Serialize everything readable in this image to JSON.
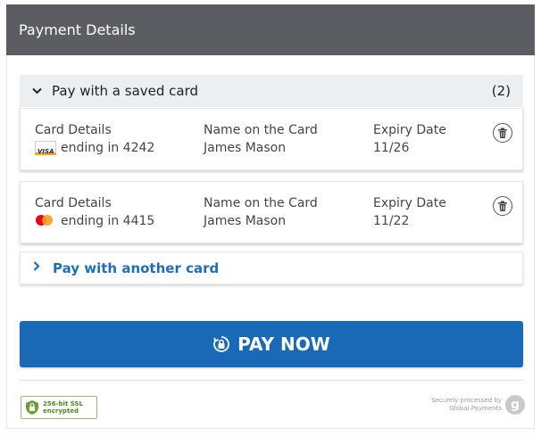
{
  "header": {
    "title": "Payment Details"
  },
  "saved_cards": {
    "heading": "Pay with a saved card",
    "count": "(2)",
    "cards": [
      {
        "card_details_label": "Card Details",
        "brand_icon": "visa-icon",
        "brand_text": "VISA",
        "ending": "ending in 4242",
        "name_label": "Name on the Card",
        "name": "James Mason",
        "expiry_label": "Expiry Date",
        "expiry": "11/26"
      },
      {
        "card_details_label": "Card Details",
        "brand_icon": "mastercard-icon",
        "ending": "ending in 4415",
        "name_label": "Name on the Card",
        "name": "James Mason",
        "expiry_label": "Expiry Date",
        "expiry": "11/22"
      }
    ]
  },
  "another_card": {
    "label": "Pay with another card"
  },
  "pay_button": {
    "label": "PAY NOW"
  },
  "footer": {
    "ssl_line1": "256-bit SSL",
    "ssl_line2": "encrypted",
    "secured_line1": "Securely processed by",
    "secured_line2": "Global Payments",
    "logo_letter": "g"
  },
  "colors": {
    "header_bg": "#5b5d63",
    "accent": "#1a69b6",
    "link": "#1e6fb7",
    "ssl_green": "#4f8a1e"
  }
}
